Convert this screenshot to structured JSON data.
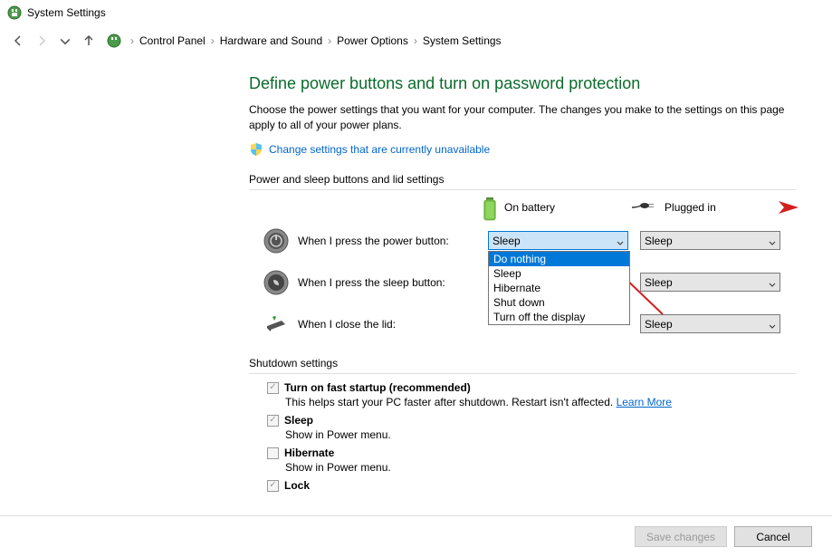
{
  "titlebar": {
    "title": "System Settings"
  },
  "nav": {
    "breadcrumb": [
      "Control Panel",
      "Hardware and Sound",
      "Power Options",
      "System Settings"
    ]
  },
  "page": {
    "title": "Define power buttons and turn on password protection",
    "description": "Choose the power settings that you want for your computer. The changes you make to the settings on this page apply to all of your power plans.",
    "changeLink": "Change settings that are currently unavailable"
  },
  "powerSection": {
    "header": "Power and sleep buttons and lid settings",
    "columns": {
      "battery": "On battery",
      "plugged": "Plugged in"
    },
    "rows": [
      {
        "label": "When I press the power button:",
        "battery": "Sleep",
        "plugged": "Sleep"
      },
      {
        "label": "When I press the sleep button:",
        "battery": "",
        "plugged": "Sleep"
      },
      {
        "label": "When I close the lid:",
        "battery": "",
        "plugged": "Sleep"
      }
    ],
    "dropdownOptions": [
      "Do nothing",
      "Sleep",
      "Hibernate",
      "Shut down",
      "Turn off the display"
    ]
  },
  "shutdown": {
    "header": "Shutdown settings",
    "items": [
      {
        "label": "Turn on fast startup (recommended)",
        "checked": true,
        "desc": "This helps start your PC faster after shutdown. Restart isn't affected.",
        "link": "Learn More"
      },
      {
        "label": "Sleep",
        "checked": true,
        "desc": "Show in Power menu."
      },
      {
        "label": "Hibernate",
        "checked": false,
        "desc": "Show in Power menu."
      },
      {
        "label": "Lock",
        "checked": true,
        "desc": ""
      }
    ]
  },
  "footer": {
    "save": "Save changes",
    "cancel": "Cancel"
  }
}
